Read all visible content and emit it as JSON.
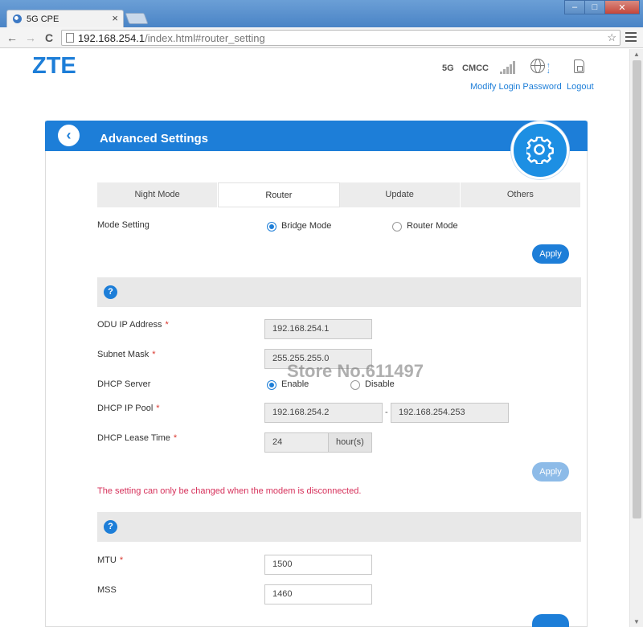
{
  "browser": {
    "tab_title": "5G CPE",
    "tab_close": "×",
    "url_host": "192.168.254.1",
    "url_path": "/index.html#router_setting",
    "nav_back": "←",
    "nav_forward": "→",
    "nav_reload": "C",
    "win_minimize": "–",
    "win_maximize": "□",
    "win_close": "✕"
  },
  "header": {
    "logo": "ZTE",
    "network_type": "5G",
    "operator": "CMCC",
    "modify_password_link": "Modify Login Password",
    "logout_link": "Logout"
  },
  "card": {
    "title": "Advanced Settings",
    "back_glyph": "‹"
  },
  "tabs": [
    {
      "label": "Night Mode",
      "active": false
    },
    {
      "label": "Router",
      "active": true
    },
    {
      "label": "Update",
      "active": false
    },
    {
      "label": "Others",
      "active": false
    }
  ],
  "mode": {
    "label": "Mode Setting",
    "options": [
      "Bridge Mode",
      "Router Mode"
    ],
    "selected": "Bridge Mode",
    "apply_label": "Apply"
  },
  "lan": {
    "help_glyph": "?",
    "odu_ip_label": "ODU IP Address",
    "odu_ip_value": "192.168.254.1",
    "subnet_label": "Subnet Mask",
    "subnet_value": "255.255.255.0",
    "dhcp_label": "DHCP Server",
    "dhcp_options": [
      "Enable",
      "Disable"
    ],
    "dhcp_selected": "Enable",
    "pool_label": "DHCP IP Pool",
    "pool_start": "192.168.254.2",
    "pool_separator": "-",
    "pool_end": "192.168.254.253",
    "lease_label": "DHCP Lease Time",
    "lease_value": "24",
    "lease_unit": "hour(s)",
    "apply_label": "Apply",
    "required_mark": "*",
    "warning": "The setting can only be changed when the modem is disconnected."
  },
  "mtu": {
    "help_glyph": "?",
    "mtu_label": "MTU",
    "mtu_value": "1500",
    "mss_label": "MSS",
    "mss_value": "1460"
  },
  "watermark": "Store No.611497",
  "colors": {
    "accent": "#1d7ed8",
    "warning": "#d6305a",
    "required": "#d9372e"
  }
}
